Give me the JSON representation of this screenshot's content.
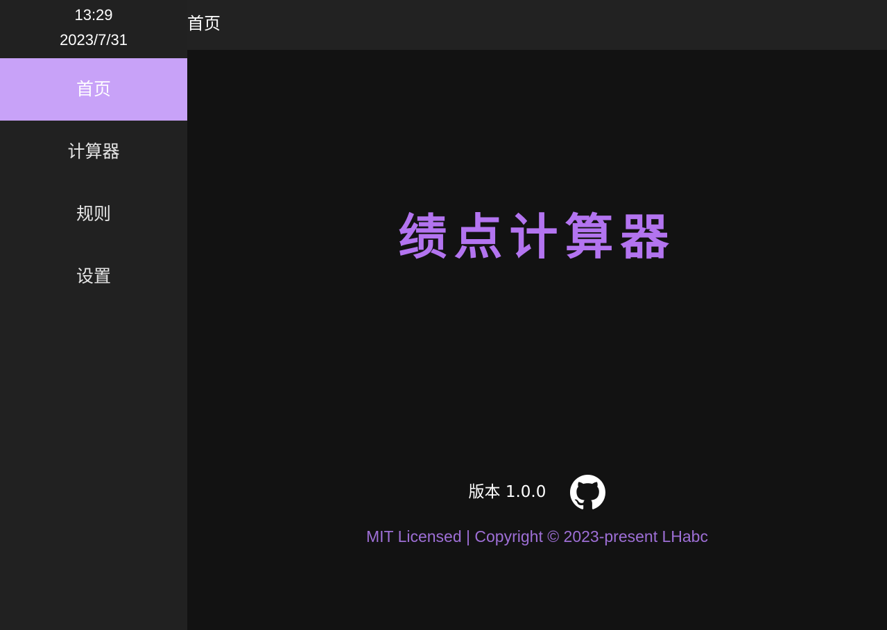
{
  "clock": {
    "time": "13:29",
    "date": "2023/7/31"
  },
  "sidebar": {
    "items": [
      {
        "label": "首页"
      },
      {
        "label": "计算器"
      },
      {
        "label": "规则"
      },
      {
        "label": "设置"
      }
    ],
    "active_index": 0
  },
  "topbar": {
    "title": "首页"
  },
  "main": {
    "app_title": "绩点计算器",
    "version_text": "版本 1.0.0",
    "github_icon": "github-icon",
    "license_text": "MIT Licensed | Copyright © 2023-present LHabc"
  },
  "colors": {
    "accent": "#c8a2f8",
    "title": "#b374f0",
    "license": "#9e6fd6",
    "sidebar_bg": "#212121",
    "main_bg": "#121212"
  }
}
